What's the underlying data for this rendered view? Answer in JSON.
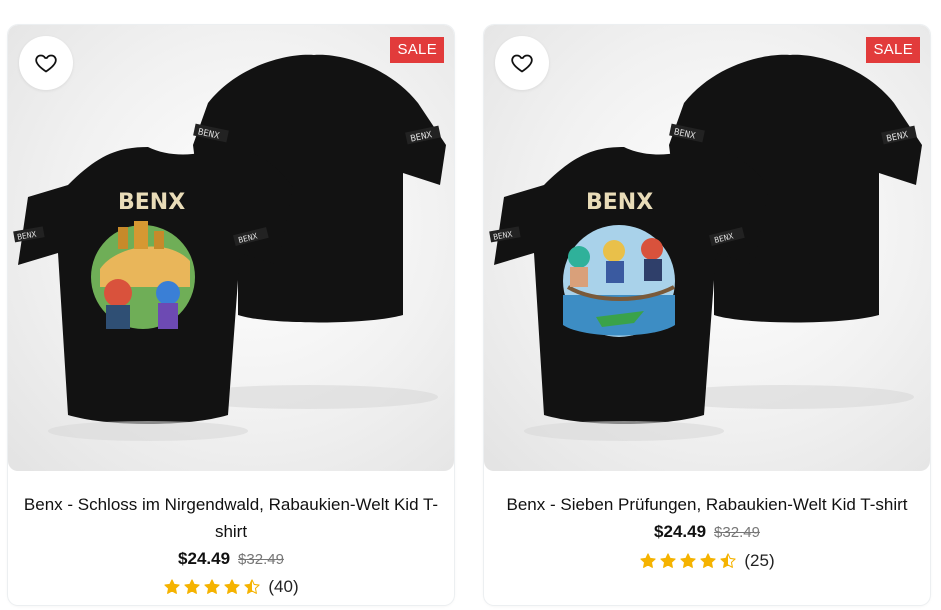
{
  "products": [
    {
      "sale_badge": "SALE",
      "print_title": "BENX",
      "sleeve_text": "BENX",
      "name": "Benx - Schloss im Nirgendwald, Rabaukien-Welt Kid T-shirt",
      "price": "$24.49",
      "old_price": "$32.49",
      "rating_value": 4.5,
      "review_count": "(40)"
    },
    {
      "sale_badge": "SALE",
      "print_title": "BENX",
      "sleeve_text": "BENX",
      "name": "Benx - Sieben Prüfungen, Rabaukien-Welt Kid T-shirt",
      "price": "$24.49",
      "old_price": "$32.49",
      "rating_value": 4.5,
      "review_count": "(25)"
    }
  ],
  "icons": {
    "wishlist": "heart-outline-icon",
    "star": "star-icon"
  },
  "colors": {
    "sale_badge": "#e23b3b",
    "star": "#f5b301",
    "shirt": "#121212"
  }
}
